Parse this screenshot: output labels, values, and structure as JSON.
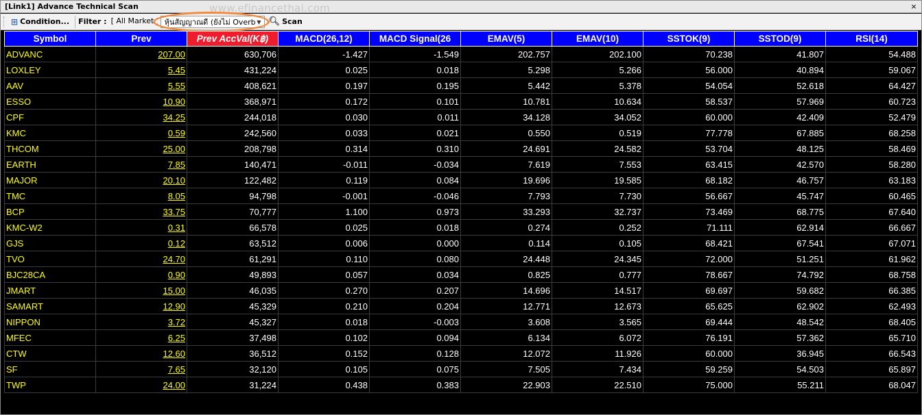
{
  "window": {
    "title": "[Link1] Advance Technical Scan",
    "close_label": "×"
  },
  "watermark": "www.efinancethai.com",
  "toolbar": {
    "condition_label": "Condition...",
    "filter_label": "Filter :",
    "market_value": "[ All Market ]",
    "scan_type_value": "หุ้นสัญญาณดี (ยังไม่ Overbought)",
    "scan_label": "Scan",
    "icons": {
      "condition": "condition-icon",
      "dropdown": "chevron-down-icon",
      "scan": "magnifier-icon"
    }
  },
  "colors": {
    "header_bg": "#0000ff",
    "sorted_header_bg": "#ee1c2c",
    "symbol_text": "#ffff00",
    "grid_bg": "#000000",
    "highlight": "#f18a3c"
  },
  "table": {
    "columns": [
      "Symbol",
      "Prev",
      "Prev AccVal(K฿)",
      "MACD(26,12)",
      "MACD Signal(26",
      "EMAV(5)",
      "EMAV(10)",
      "SSTOK(9)",
      "SSTOD(9)",
      "RSI(14)"
    ],
    "sorted_column": 2,
    "rows": [
      [
        "ADVANC",
        "207.00",
        "630,706",
        "-1.427",
        "-1.549",
        "202.757",
        "202.100",
        "70.238",
        "41.807",
        "54.488"
      ],
      [
        "LOXLEY",
        "5.45",
        "431,224",
        "0.025",
        "0.018",
        "5.298",
        "5.266",
        "56.000",
        "40.894",
        "59.067"
      ],
      [
        "AAV",
        "5.55",
        "408,621",
        "0.197",
        "0.195",
        "5.442",
        "5.378",
        "54.054",
        "52.618",
        "64.427"
      ],
      [
        "ESSO",
        "10.90",
        "368,971",
        "0.172",
        "0.101",
        "10.781",
        "10.634",
        "58.537",
        "57.969",
        "60.723"
      ],
      [
        "CPF",
        "34.25",
        "244,018",
        "0.030",
        "0.011",
        "34.128",
        "34.052",
        "60.000",
        "42.409",
        "52.479"
      ],
      [
        "KMC",
        "0.59",
        "242,560",
        "0.033",
        "0.021",
        "0.550",
        "0.519",
        "77.778",
        "67.885",
        "68.258"
      ],
      [
        "THCOM",
        "25.00",
        "208,798",
        "0.314",
        "0.310",
        "24.691",
        "24.582",
        "53.704",
        "48.125",
        "58.469"
      ],
      [
        "EARTH",
        "7.85",
        "140,471",
        "-0.011",
        "-0.034",
        "7.619",
        "7.553",
        "63.415",
        "42.570",
        "58.280"
      ],
      [
        "MAJOR",
        "20.10",
        "122,482",
        "0.119",
        "0.084",
        "19.696",
        "19.585",
        "68.182",
        "46.757",
        "63.183"
      ],
      [
        "TMC",
        "8.05",
        "94,798",
        "-0.001",
        "-0.046",
        "7.793",
        "7.730",
        "56.667",
        "45.747",
        "60.465"
      ],
      [
        "BCP",
        "33.75",
        "70,777",
        "1.100",
        "0.973",
        "33.293",
        "32.737",
        "73.469",
        "68.775",
        "67.640"
      ],
      [
        "KMC-W2",
        "0.31",
        "66,578",
        "0.025",
        "0.018",
        "0.274",
        "0.252",
        "71.111",
        "62.914",
        "66.667"
      ],
      [
        "GJS",
        "0.12",
        "63,512",
        "0.006",
        "0.000",
        "0.114",
        "0.105",
        "68.421",
        "67.541",
        "67.071"
      ],
      [
        "TVO",
        "24.70",
        "61,291",
        "0.110",
        "0.080",
        "24.448",
        "24.345",
        "72.000",
        "51.251",
        "61.962"
      ],
      [
        "BJC28CA",
        "0.90",
        "49,893",
        "0.057",
        "0.034",
        "0.825",
        "0.777",
        "78.667",
        "74.792",
        "68.758"
      ],
      [
        "JMART",
        "15.00",
        "46,035",
        "0.270",
        "0.207",
        "14.696",
        "14.517",
        "69.697",
        "59.682",
        "66.385"
      ],
      [
        "SAMART",
        "12.90",
        "45,329",
        "0.210",
        "0.204",
        "12.771",
        "12.673",
        "65.625",
        "62.902",
        "62.493"
      ],
      [
        "NIPPON",
        "3.72",
        "45,327",
        "0.018",
        "-0.003",
        "3.608",
        "3.565",
        "69.444",
        "48.542",
        "68.405"
      ],
      [
        "MFEC",
        "6.25",
        "37,498",
        "0.102",
        "0.094",
        "6.134",
        "6.072",
        "76.191",
        "57.362",
        "65.710"
      ],
      [
        "CTW",
        "12.60",
        "36,512",
        "0.152",
        "0.128",
        "12.072",
        "11.926",
        "60.000",
        "36.945",
        "66.543"
      ],
      [
        "SF",
        "7.65",
        "32,120",
        "0.105",
        "0.075",
        "7.505",
        "7.434",
        "59.259",
        "54.503",
        "65.897"
      ],
      [
        "TWP",
        "24.00",
        "31,224",
        "0.438",
        "0.383",
        "22.903",
        "22.510",
        "75.000",
        "55.211",
        "68.047"
      ]
    ]
  }
}
